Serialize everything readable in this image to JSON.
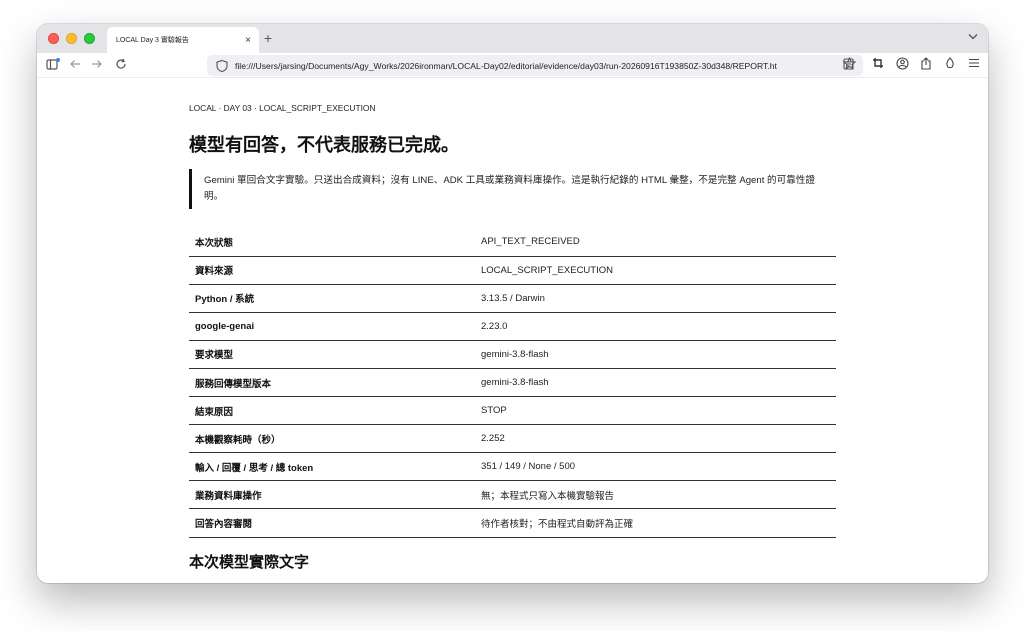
{
  "browser": {
    "tab_title": "LOCAL Day 3 實驗報告",
    "tab_close": "×",
    "new_tab": "+",
    "url": "file:///Users/jarsing/Documents/Agy_Works/2026ironman/LOCAL-Day02/editorial/evidence/day03/run-20260916T193850Z-30d348/REPORT.ht"
  },
  "report": {
    "eyebrow": "LOCAL · DAY 03 · LOCAL_SCRIPT_EXECUTION",
    "title": "模型有回答，不代表服務已完成。",
    "callout": "Gemini 單回合文字實驗。只送出合成資料；沒有 LINE、ADK 工具或業務資料庫操作。這是執行紀錄的 HTML 彙整，不是完整 Agent 的可靠性證明。",
    "rows": [
      {
        "key": "本次狀態",
        "value": "API_TEXT_RECEIVED"
      },
      {
        "key": "資料來源",
        "value": "LOCAL_SCRIPT_EXECUTION"
      },
      {
        "key": "Python / 系統",
        "value": "3.13.5 / Darwin"
      },
      {
        "key": "google-genai",
        "value": "2.23.0"
      },
      {
        "key": "要求模型",
        "value": "gemini-3.8-flash"
      },
      {
        "key": "服務回傳模型版本",
        "value": "gemini-3.8-flash"
      },
      {
        "key": "結束原因",
        "value": "STOP"
      },
      {
        "key": "本機觀察耗時（秒）",
        "value": "2.252"
      },
      {
        "key": "輸入 / 回覆 / 思考 / 總 token",
        "value": "351 / 149 / None / 500"
      },
      {
        "key": "業務資料庫操作",
        "value": "無；本程式只寫入本機實驗報告"
      },
      {
        "key": "回答內容審閱",
        "value": "待作者核對；不由程式自動評為正確"
      }
    ],
    "section_heading": "本次模型實際文字"
  }
}
